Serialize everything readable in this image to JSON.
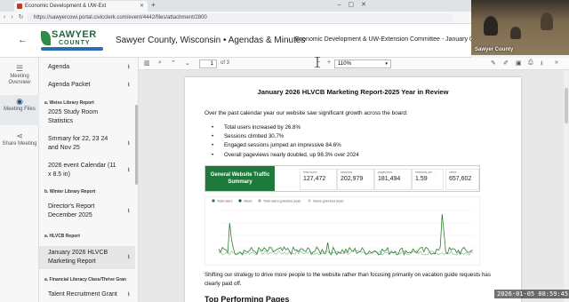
{
  "browser": {
    "tab_title": "Economic Development & UW-Ext",
    "url": "https://sawyercowi.portal.civicclerk.com/event/4442/files/attachment/2800"
  },
  "header": {
    "logo_line1": "SAWYER",
    "logo_line2": "COUNTY",
    "site_title": "Sawyer County, Wisconsin • Agendas & Minutes",
    "committee": "Economic Development & UW-Extension Committee - January 05, 2026"
  },
  "rail": {
    "items": [
      {
        "label": "Meeting Overview",
        "icon": "list-icon"
      },
      {
        "label": "Meeting Files",
        "icon": "eye-icon"
      },
      {
        "label": "Share Meeting",
        "icon": "share-icon"
      }
    ]
  },
  "files": {
    "agenda": "Agenda",
    "agenda_packet": "Agenda Packet",
    "section_a": "a. Weiss Library Report",
    "study_room_1": "2025 Study Room",
    "study_room_2": "Statistics",
    "summary_1": "Smmary for 22, 23 24",
    "summary_2": "and Nov 25",
    "event_cal_1": "2026 event Calendar (11",
    "event_cal_2": "x 8.5 in)",
    "section_b": "b. Winter Library Report",
    "directors_1": "Director's Report",
    "directors_2": "December 2025",
    "section_hlvcb": "a. HLVCB Report",
    "jan_report_1": "January 2026 HLVCB",
    "jan_report_2": "Marketing Report",
    "section_fin": "a. Financial Literacy Class/Thrive Gran",
    "talent": "Talent Recruitment Grant"
  },
  "pdf_toolbar": {
    "page_current": "1",
    "page_total": "of 3",
    "zoom": "110%"
  },
  "document": {
    "title": "January 2026 HLVCB Marketing Report-2025 Year in Review",
    "intro": "Over the past calendar year our website saw significant growth across the board:",
    "bullets": [
      "Total users increased by 26.8%",
      "Sessions climbed 30.7%",
      "Engaged sessions jumped an impressive 84.6%",
      "Overall pageviews nearly doubled, up 98.3% over 2024"
    ],
    "summary_label": "General Website Traffic Summary",
    "kpis": [
      {
        "label": "total users",
        "value": "127,472"
      },
      {
        "label": "sessions",
        "value": "202,979"
      },
      {
        "label": "pageviews",
        "value": "181,494"
      },
      {
        "label": "sessions per ...",
        "value": "1.59"
      },
      {
        "label": "views",
        "value": "657,602"
      }
    ],
    "legend": [
      "Total users",
      "Views",
      "Total users (previous year)",
      "Views (previous year)"
    ],
    "para": "Shifting our strategy to drive more people to the website rather than focusing primarily on vacation guide requests has clearly paid off.",
    "h2": "Top Performing Pages"
  },
  "video": {
    "label": "Sawyer County"
  },
  "timestamp": "2026-01-05  08:59:45",
  "colors": {
    "brand_green": "#1e7a3a",
    "line_green": "#2e7d32",
    "line_light": "#8fbf9a"
  }
}
